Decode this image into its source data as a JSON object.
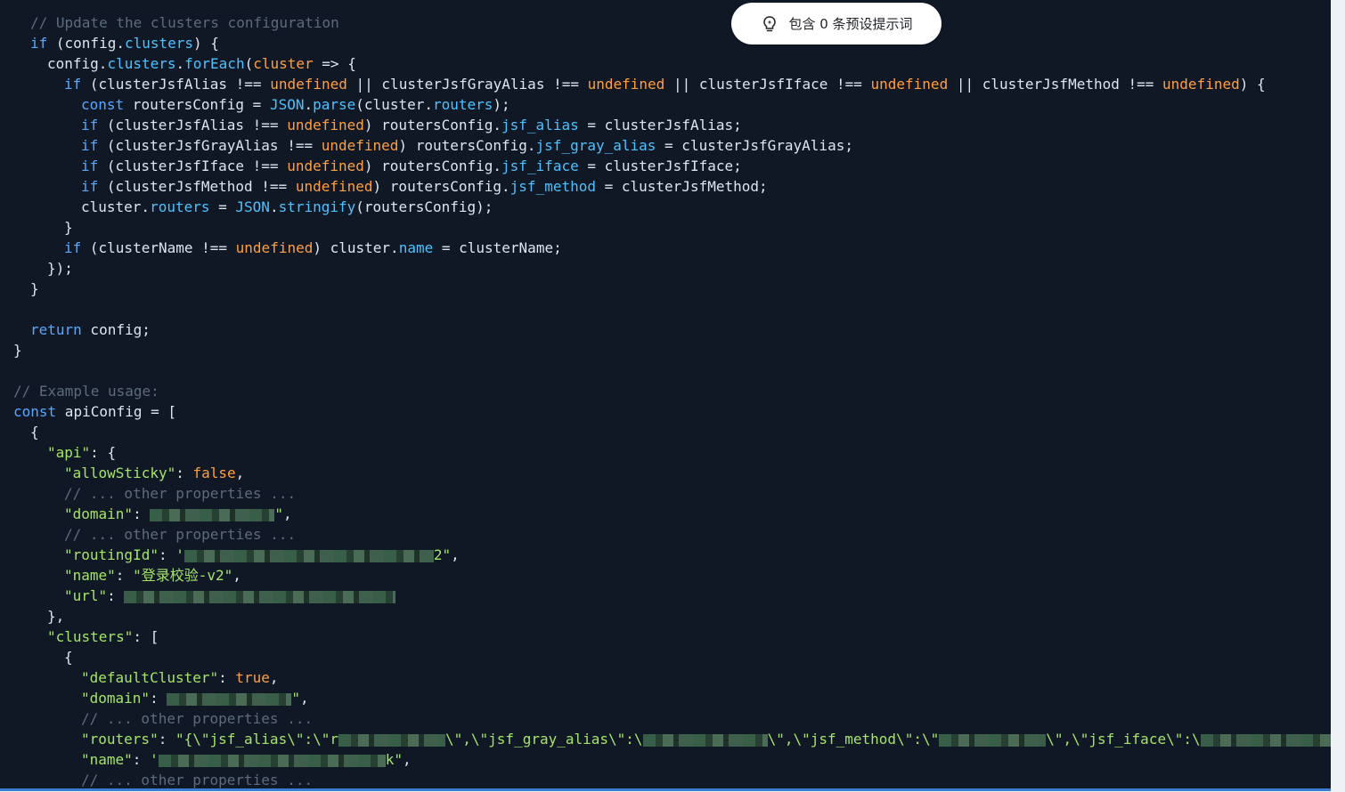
{
  "prompt_chip": {
    "label": "包含 0 条预设提示词",
    "icon": "sparkle-bulb-icon"
  },
  "colors": {
    "background": "#0f1824",
    "keyword": "#5aa7ff",
    "comment": "#5d6b7d",
    "property": "#4fc1ff",
    "undefined": "#ff9f43",
    "string": "#a6e36a",
    "text": "#dfe5ee"
  },
  "code_lines": [
    {
      "indent": 1,
      "tokens": [
        [
          "comment",
          "// Update the clusters configuration"
        ]
      ]
    },
    {
      "indent": 1,
      "tokens": [
        [
          "kw",
          "if"
        ],
        [
          "plain",
          " (config."
        ],
        [
          "prop",
          "clusters"
        ],
        [
          "plain",
          ") {"
        ]
      ]
    },
    {
      "indent": 2,
      "tokens": [
        [
          "plain",
          "config."
        ],
        [
          "prop",
          "clusters"
        ],
        [
          "plain",
          "."
        ],
        [
          "func",
          "forEach"
        ],
        [
          "plain",
          "("
        ],
        [
          "undef",
          "cluster"
        ],
        [
          "plain",
          " => {"
        ]
      ]
    },
    {
      "indent": 3,
      "tokens": [
        [
          "kw",
          "if"
        ],
        [
          "plain",
          " (clusterJsfAlias !== "
        ],
        [
          "undef",
          "undefined"
        ],
        [
          "plain",
          " || clusterJsfGrayAlias !== "
        ],
        [
          "undef",
          "undefined"
        ],
        [
          "plain",
          " || clusterJsfIface !== "
        ],
        [
          "undef",
          "undefined"
        ],
        [
          "plain",
          " || clusterJsfMethod !== "
        ],
        [
          "undef",
          "undefined"
        ],
        [
          "plain",
          ") {"
        ]
      ]
    },
    {
      "indent": 4,
      "tokens": [
        [
          "kw",
          "const"
        ],
        [
          "plain",
          " routersConfig = "
        ],
        [
          "func",
          "JSON"
        ],
        [
          "plain",
          "."
        ],
        [
          "func",
          "parse"
        ],
        [
          "plain",
          "(cluster."
        ],
        [
          "prop",
          "routers"
        ],
        [
          "plain",
          ");"
        ]
      ]
    },
    {
      "indent": 4,
      "tokens": [
        [
          "kw",
          "if"
        ],
        [
          "plain",
          " (clusterJsfAlias !== "
        ],
        [
          "undef",
          "undefined"
        ],
        [
          "plain",
          ") routersConfig."
        ],
        [
          "prop",
          "jsf_alias"
        ],
        [
          "plain",
          " = clusterJsfAlias;"
        ]
      ]
    },
    {
      "indent": 4,
      "tokens": [
        [
          "kw",
          "if"
        ],
        [
          "plain",
          " (clusterJsfGrayAlias !== "
        ],
        [
          "undef",
          "undefined"
        ],
        [
          "plain",
          ") routersConfig."
        ],
        [
          "prop",
          "jsf_gray_alias"
        ],
        [
          "plain",
          " = clusterJsfGrayAlias;"
        ]
      ]
    },
    {
      "indent": 4,
      "tokens": [
        [
          "kw",
          "if"
        ],
        [
          "plain",
          " (clusterJsfIface !== "
        ],
        [
          "undef",
          "undefined"
        ],
        [
          "plain",
          ") routersConfig."
        ],
        [
          "prop",
          "jsf_iface"
        ],
        [
          "plain",
          " = clusterJsfIface;"
        ]
      ]
    },
    {
      "indent": 4,
      "tokens": [
        [
          "kw",
          "if"
        ],
        [
          "plain",
          " (clusterJsfMethod !== "
        ],
        [
          "undef",
          "undefined"
        ],
        [
          "plain",
          ") routersConfig."
        ],
        [
          "prop",
          "jsf_method"
        ],
        [
          "plain",
          " = clusterJsfMethod;"
        ]
      ]
    },
    {
      "indent": 4,
      "tokens": [
        [
          "plain",
          "cluster."
        ],
        [
          "prop",
          "routers"
        ],
        [
          "plain",
          " = "
        ],
        [
          "func",
          "JSON"
        ],
        [
          "plain",
          "."
        ],
        [
          "func",
          "stringify"
        ],
        [
          "plain",
          "(routersConfig);"
        ]
      ]
    },
    {
      "indent": 3,
      "tokens": [
        [
          "plain",
          "}"
        ]
      ]
    },
    {
      "indent": 3,
      "tokens": [
        [
          "kw",
          "if"
        ],
        [
          "plain",
          " (clusterName !== "
        ],
        [
          "undef",
          "undefined"
        ],
        [
          "plain",
          ") cluster."
        ],
        [
          "prop",
          "name"
        ],
        [
          "plain",
          " = clusterName;"
        ]
      ]
    },
    {
      "indent": 2,
      "tokens": [
        [
          "plain",
          "});"
        ]
      ]
    },
    {
      "indent": 1,
      "tokens": [
        [
          "plain",
          "}"
        ]
      ]
    },
    {
      "indent": 0,
      "tokens": []
    },
    {
      "indent": 1,
      "tokens": [
        [
          "kw",
          "return"
        ],
        [
          "plain",
          " config;"
        ]
      ]
    },
    {
      "indent": 0,
      "tokens": [
        [
          "plain",
          "}"
        ]
      ]
    },
    {
      "indent": 0,
      "tokens": []
    },
    {
      "indent": 0,
      "tokens": [
        [
          "comment",
          "// Example usage:"
        ]
      ]
    },
    {
      "indent": 0,
      "tokens": [
        [
          "kw",
          "const"
        ],
        [
          "plain",
          " apiConfig = ["
        ]
      ]
    },
    {
      "indent": 1,
      "tokens": [
        [
          "plain",
          "{"
        ]
      ]
    },
    {
      "indent": 2,
      "tokens": [
        [
          "key",
          "\"api\""
        ],
        [
          "plain",
          ": {"
        ]
      ]
    },
    {
      "indent": 3,
      "tokens": [
        [
          "key",
          "\"allowSticky\""
        ],
        [
          "plain",
          ": "
        ],
        [
          "bool",
          "false"
        ],
        [
          "plain",
          ","
        ]
      ]
    },
    {
      "indent": 3,
      "tokens": [
        [
          "comment",
          "// ... other properties ..."
        ]
      ]
    },
    {
      "indent": 3,
      "tokens": [
        [
          "key",
          "\"domain\""
        ],
        [
          "plain",
          ": "
        ],
        [
          "mask",
          "140"
        ],
        [
          "string",
          "\""
        ],
        [
          "plain",
          ","
        ]
      ]
    },
    {
      "indent": 3,
      "tokens": [
        [
          "comment",
          "// ... other properties ..."
        ]
      ]
    },
    {
      "indent": 3,
      "tokens": [
        [
          "key",
          "\"routingId\""
        ],
        [
          "plain",
          ": "
        ],
        [
          "string",
          "'"
        ],
        [
          "mask",
          "280"
        ],
        [
          "string",
          "2\""
        ],
        [
          "plain",
          ","
        ]
      ]
    },
    {
      "indent": 3,
      "tokens": [
        [
          "key",
          "\"name\""
        ],
        [
          "plain",
          ": "
        ],
        [
          "string",
          "\"登录校验-v2\""
        ],
        [
          "plain",
          ","
        ]
      ]
    },
    {
      "indent": 3,
      "tokens": [
        [
          "key",
          "\"url\""
        ],
        [
          "plain",
          ": "
        ],
        [
          "mask",
          "305"
        ]
      ]
    },
    {
      "indent": 2,
      "tokens": [
        [
          "plain",
          "},"
        ]
      ]
    },
    {
      "indent": 2,
      "tokens": [
        [
          "key",
          "\"clusters\""
        ],
        [
          "plain",
          ": ["
        ]
      ]
    },
    {
      "indent": 3,
      "tokens": [
        [
          "plain",
          "{"
        ]
      ]
    },
    {
      "indent": 4,
      "tokens": [
        [
          "key",
          "\"defaultCluster\""
        ],
        [
          "plain",
          ": "
        ],
        [
          "bool",
          "true"
        ],
        [
          "plain",
          ","
        ]
      ]
    },
    {
      "indent": 4,
      "tokens": [
        [
          "key",
          "\"domain\""
        ],
        [
          "plain",
          ": "
        ],
        [
          "mask",
          "140"
        ],
        [
          "string",
          "\""
        ],
        [
          "plain",
          ","
        ]
      ]
    },
    {
      "indent": 4,
      "tokens": [
        [
          "comment",
          "// ... other properties ..."
        ]
      ]
    },
    {
      "indent": 4,
      "tokens": [
        [
          "key",
          "\"routers\""
        ],
        [
          "plain",
          ": "
        ],
        [
          "string",
          "\"{\\\"jsf_alias\\\":\\\"r"
        ],
        [
          "mask",
          "120"
        ],
        [
          "string",
          "\\\",\\\"jsf_gray_alias\\\":\\"
        ],
        [
          "mask",
          "140"
        ],
        [
          "string",
          "\\\",\\\"jsf_method\\\":\\\""
        ],
        [
          "mask",
          "120"
        ],
        [
          "string",
          "\\\",\\\"jsf_iface\\\":\\"
        ],
        [
          "mask",
          "150"
        ]
      ]
    },
    {
      "indent": 4,
      "tokens": [
        [
          "key",
          "\"name\""
        ],
        [
          "plain",
          ": "
        ],
        [
          "string",
          "'"
        ],
        [
          "mask",
          "255"
        ],
        [
          "string",
          "k\""
        ],
        [
          "plain",
          ","
        ]
      ]
    },
    {
      "indent": 4,
      "tokens": [
        [
          "comment",
          "// ... other properties ..."
        ]
      ]
    }
  ]
}
